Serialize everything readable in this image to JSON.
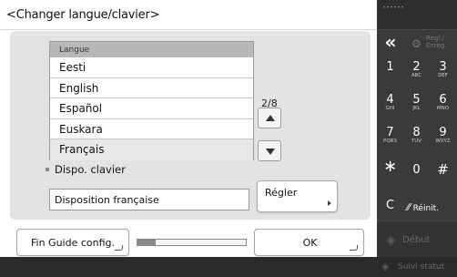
{
  "title": "<Changer langue/clavier>",
  "language_list": {
    "header": "Langue",
    "items": [
      "Eesti",
      "English",
      "Español",
      "Euskara",
      "Français"
    ],
    "selected_index": 4
  },
  "pagination": {
    "text": "2/8"
  },
  "keyboard": {
    "label": "Dispo. clavier",
    "value": "Disposition française",
    "set_button": "Régler"
  },
  "footer": {
    "fin_button": "Fin Guide config.",
    "progress_fraction": 0.17,
    "ok_button": "OK"
  },
  "keypad": {
    "back": "«",
    "reg": [
      "Régl./",
      "Enreg."
    ],
    "keys": [
      {
        "num": "1",
        "sub": ""
      },
      {
        "num": "2",
        "sub": "ABC"
      },
      {
        "num": "3",
        "sub": "DEF"
      },
      {
        "num": "4",
        "sub": "GHI"
      },
      {
        "num": "5",
        "sub": "JKL"
      },
      {
        "num": "6",
        "sub": "MNO"
      },
      {
        "num": "7",
        "sub": "PQRS"
      },
      {
        "num": "8",
        "sub": "TUV"
      },
      {
        "num": "9",
        "sub": "WXYZ"
      }
    ],
    "star": "∗",
    "zero": "0",
    "hash": "#",
    "clear": "C",
    "reset": "Réinit.",
    "start": "Début",
    "status": "Suivi statut"
  }
}
